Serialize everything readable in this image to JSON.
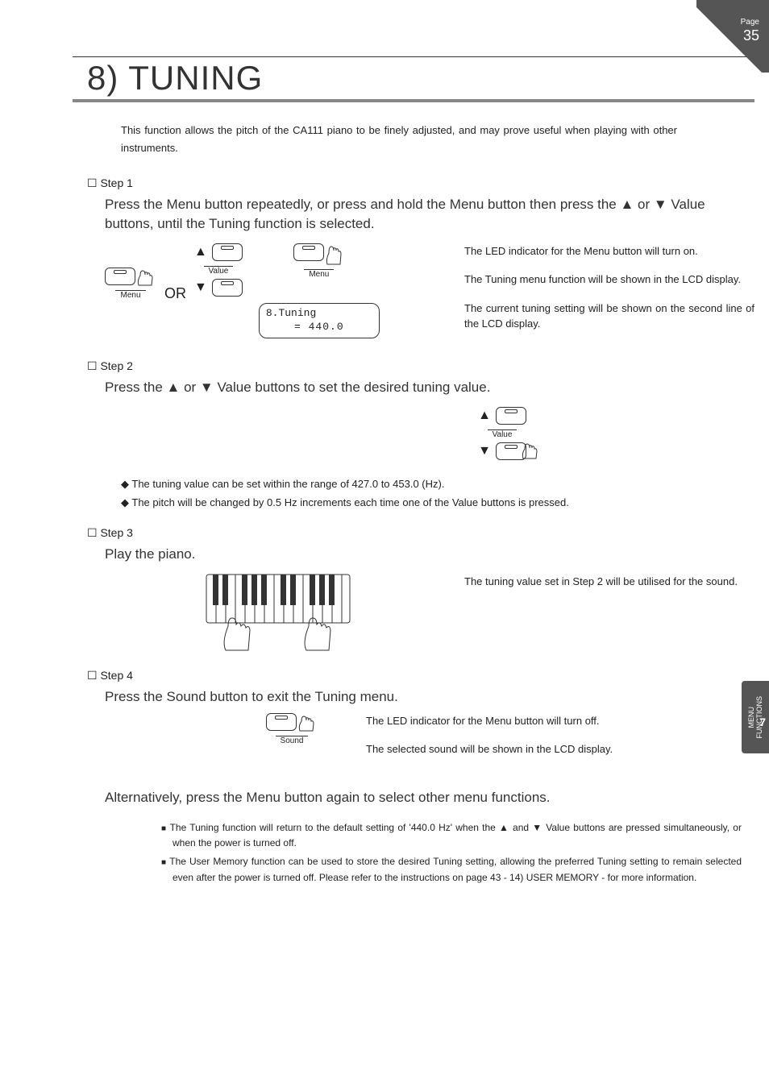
{
  "page": {
    "label": "Page",
    "number": "35"
  },
  "sideTab": {
    "line1": "MENU",
    "line2": "FUNCTIONS",
    "num": "7"
  },
  "title": "8) TUNING",
  "intro": "This function allows the pitch of the CA111 piano to be finely adjusted, and may prove useful when playing with other instruments.",
  "step1": {
    "head": "☐ Step 1",
    "sub": "Press the Menu button repeatedly, or press and hold the Menu button then press the ▲ or ▼ Value buttons, until the Tuning function is selected.",
    "or": "OR",
    "menuLabel": "Menu",
    "valueLabel": "Value",
    "lcdLine1": "8.Tuning",
    "lcdLine2": "= 440.0",
    "side1": "The LED indicator for the Menu button will turn on.",
    "side2": "The Tuning menu function will be shown in the LCD display.",
    "side3": "The current tuning setting will be shown on the second line of the LCD display."
  },
  "step2": {
    "head": "☐ Step 2",
    "sub": "Press the ▲ or ▼ Value buttons to set the desired tuning value.",
    "valueLabel": "Value",
    "d1": "The tuning value can be set within the range of 427.0 to 453.0 (Hz).",
    "d2": "The pitch will be changed by 0.5 Hz increments each time one of the Value buttons is pressed."
  },
  "step3": {
    "head": "☐ Step 3",
    "sub": "Play the piano.",
    "side": "The tuning value set in Step 2 will be utilised for the sound."
  },
  "step4": {
    "head": "☐ Step 4",
    "sub": "Press the Sound button to exit the Tuning menu.",
    "soundLabel": "Sound",
    "side1": "The LED indicator for the Menu button will turn off.",
    "side2": "The selected sound will be shown in the LCD display."
  },
  "altLine": "Alternatively, press the Menu button again to select other menu functions.",
  "notes": {
    "n1": "The Tuning function will return to the default setting of '440.0 Hz' when the ▲ and ▼ Value buttons are pressed simultaneously, or when the power is turned off.",
    "n2": "The User Memory function can be used to store the desired Tuning setting, allowing the preferred Tuning setting to remain selected even after the power is turned off.  Please refer to the instructions on page 43 - 14) USER MEMORY - for more information."
  }
}
